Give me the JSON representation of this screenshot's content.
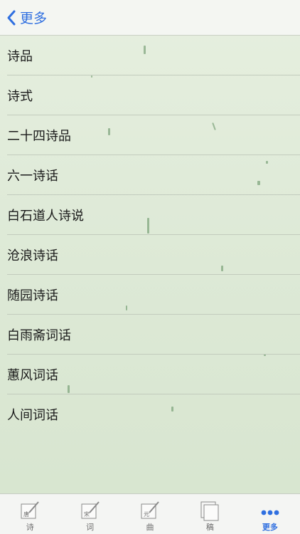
{
  "nav": {
    "back_label": "更多"
  },
  "items": [
    {
      "label": "诗品"
    },
    {
      "label": "诗式"
    },
    {
      "label": "二十四诗品"
    },
    {
      "label": "六一诗话"
    },
    {
      "label": "白石道人诗说"
    },
    {
      "label": "沧浪诗话"
    },
    {
      "label": "随园诗话"
    },
    {
      "label": "白雨斋词话"
    },
    {
      "label": "蕙风词话"
    },
    {
      "label": "人间词话"
    }
  ],
  "tabs": [
    {
      "label": "诗",
      "icon_char": "唐",
      "icon": "pencil-paper-icon"
    },
    {
      "label": "词",
      "icon_char": "宋",
      "icon": "pencil-paper-icon"
    },
    {
      "label": "曲",
      "icon_char": "元",
      "icon": "pencil-paper-icon"
    },
    {
      "label": "稿",
      "icon": "stacked-pages-icon"
    },
    {
      "label": "更多",
      "icon": "more-dots-icon",
      "active": true
    }
  ],
  "colors": {
    "accent": "#2f6fe0",
    "background": "#dde9d6"
  }
}
